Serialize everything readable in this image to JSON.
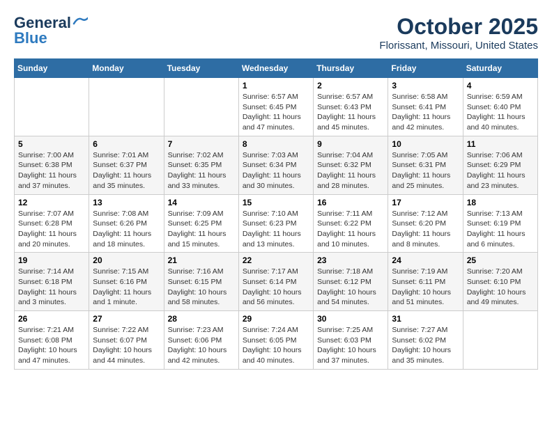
{
  "header": {
    "logo_line1": "General",
    "logo_line2": "Blue",
    "title": "October 2025",
    "subtitle": "Florissant, Missouri, United States"
  },
  "weekdays": [
    "Sunday",
    "Monday",
    "Tuesday",
    "Wednesday",
    "Thursday",
    "Friday",
    "Saturday"
  ],
  "weeks": [
    [
      {
        "day": "",
        "info": ""
      },
      {
        "day": "",
        "info": ""
      },
      {
        "day": "",
        "info": ""
      },
      {
        "day": "1",
        "info": "Sunrise: 6:57 AM\nSunset: 6:45 PM\nDaylight: 11 hours and 47 minutes."
      },
      {
        "day": "2",
        "info": "Sunrise: 6:57 AM\nSunset: 6:43 PM\nDaylight: 11 hours and 45 minutes."
      },
      {
        "day": "3",
        "info": "Sunrise: 6:58 AM\nSunset: 6:41 PM\nDaylight: 11 hours and 42 minutes."
      },
      {
        "day": "4",
        "info": "Sunrise: 6:59 AM\nSunset: 6:40 PM\nDaylight: 11 hours and 40 minutes."
      }
    ],
    [
      {
        "day": "5",
        "info": "Sunrise: 7:00 AM\nSunset: 6:38 PM\nDaylight: 11 hours and 37 minutes."
      },
      {
        "day": "6",
        "info": "Sunrise: 7:01 AM\nSunset: 6:37 PM\nDaylight: 11 hours and 35 minutes."
      },
      {
        "day": "7",
        "info": "Sunrise: 7:02 AM\nSunset: 6:35 PM\nDaylight: 11 hours and 33 minutes."
      },
      {
        "day": "8",
        "info": "Sunrise: 7:03 AM\nSunset: 6:34 PM\nDaylight: 11 hours and 30 minutes."
      },
      {
        "day": "9",
        "info": "Sunrise: 7:04 AM\nSunset: 6:32 PM\nDaylight: 11 hours and 28 minutes."
      },
      {
        "day": "10",
        "info": "Sunrise: 7:05 AM\nSunset: 6:31 PM\nDaylight: 11 hours and 25 minutes."
      },
      {
        "day": "11",
        "info": "Sunrise: 7:06 AM\nSunset: 6:29 PM\nDaylight: 11 hours and 23 minutes."
      }
    ],
    [
      {
        "day": "12",
        "info": "Sunrise: 7:07 AM\nSunset: 6:28 PM\nDaylight: 11 hours and 20 minutes."
      },
      {
        "day": "13",
        "info": "Sunrise: 7:08 AM\nSunset: 6:26 PM\nDaylight: 11 hours and 18 minutes."
      },
      {
        "day": "14",
        "info": "Sunrise: 7:09 AM\nSunset: 6:25 PM\nDaylight: 11 hours and 15 minutes."
      },
      {
        "day": "15",
        "info": "Sunrise: 7:10 AM\nSunset: 6:23 PM\nDaylight: 11 hours and 13 minutes."
      },
      {
        "day": "16",
        "info": "Sunrise: 7:11 AM\nSunset: 6:22 PM\nDaylight: 11 hours and 10 minutes."
      },
      {
        "day": "17",
        "info": "Sunrise: 7:12 AM\nSunset: 6:20 PM\nDaylight: 11 hours and 8 minutes."
      },
      {
        "day": "18",
        "info": "Sunrise: 7:13 AM\nSunset: 6:19 PM\nDaylight: 11 hours and 6 minutes."
      }
    ],
    [
      {
        "day": "19",
        "info": "Sunrise: 7:14 AM\nSunset: 6:18 PM\nDaylight: 11 hours and 3 minutes."
      },
      {
        "day": "20",
        "info": "Sunrise: 7:15 AM\nSunset: 6:16 PM\nDaylight: 11 hours and 1 minute."
      },
      {
        "day": "21",
        "info": "Sunrise: 7:16 AM\nSunset: 6:15 PM\nDaylight: 10 hours and 58 minutes."
      },
      {
        "day": "22",
        "info": "Sunrise: 7:17 AM\nSunset: 6:14 PM\nDaylight: 10 hours and 56 minutes."
      },
      {
        "day": "23",
        "info": "Sunrise: 7:18 AM\nSunset: 6:12 PM\nDaylight: 10 hours and 54 minutes."
      },
      {
        "day": "24",
        "info": "Sunrise: 7:19 AM\nSunset: 6:11 PM\nDaylight: 10 hours and 51 minutes."
      },
      {
        "day": "25",
        "info": "Sunrise: 7:20 AM\nSunset: 6:10 PM\nDaylight: 10 hours and 49 minutes."
      }
    ],
    [
      {
        "day": "26",
        "info": "Sunrise: 7:21 AM\nSunset: 6:08 PM\nDaylight: 10 hours and 47 minutes."
      },
      {
        "day": "27",
        "info": "Sunrise: 7:22 AM\nSunset: 6:07 PM\nDaylight: 10 hours and 44 minutes."
      },
      {
        "day": "28",
        "info": "Sunrise: 7:23 AM\nSunset: 6:06 PM\nDaylight: 10 hours and 42 minutes."
      },
      {
        "day": "29",
        "info": "Sunrise: 7:24 AM\nSunset: 6:05 PM\nDaylight: 10 hours and 40 minutes."
      },
      {
        "day": "30",
        "info": "Sunrise: 7:25 AM\nSunset: 6:03 PM\nDaylight: 10 hours and 37 minutes."
      },
      {
        "day": "31",
        "info": "Sunrise: 7:27 AM\nSunset: 6:02 PM\nDaylight: 10 hours and 35 minutes."
      },
      {
        "day": "",
        "info": ""
      }
    ]
  ]
}
